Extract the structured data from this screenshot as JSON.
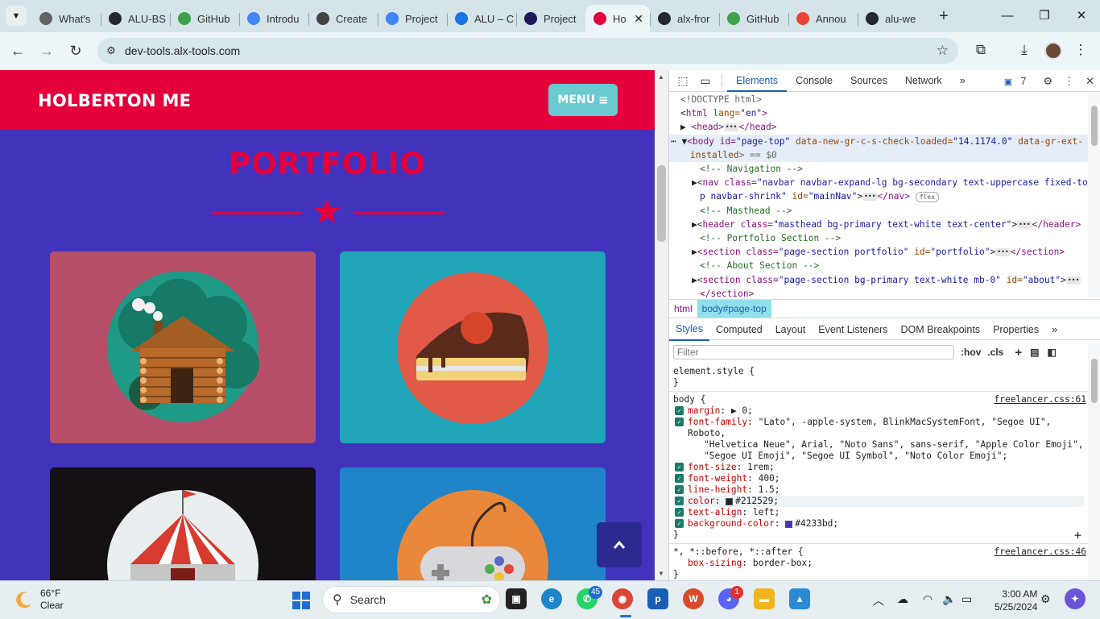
{
  "browser": {
    "tabs": [
      {
        "title": "What's",
        "icon": "chrome-icon",
        "color": "#5f6368"
      },
      {
        "title": "ALU-BS",
        "icon": "github-icon",
        "color": "#24292f"
      },
      {
        "title": "GitHub",
        "icon": "github-icon",
        "color": "#3fa14a"
      },
      {
        "title": "Introdu",
        "icon": "docs-icon",
        "color": "#4285f4"
      },
      {
        "title": "Create",
        "icon": "openai-icon",
        "color": "#444"
      },
      {
        "title": "Project",
        "icon": "docs-icon",
        "color": "#4285f4"
      },
      {
        "title": "ALU – C",
        "icon": "calendar-icon",
        "color": "#1a73e8"
      },
      {
        "title": "Project",
        "icon": "alx-icon",
        "color": "#1c1c5c"
      },
      {
        "title": "Ho",
        "icon": "holberton-icon",
        "color": "#e6003b",
        "active": true
      },
      {
        "title": "alx-fror",
        "icon": "github-icon",
        "color": "#24292f"
      },
      {
        "title": "GitHub",
        "icon": "github-icon",
        "color": "#3fa14a"
      },
      {
        "title": "Annou",
        "icon": "gmail-icon",
        "color": "#ea4335"
      },
      {
        "title": "alu-we",
        "icon": "github-icon",
        "color": "#24292f"
      }
    ],
    "url": "dev-tools.alx-tools.com"
  },
  "page": {
    "brand": "HOLBERTON ME",
    "menu_label": "MENU",
    "title": "PORTFOLIO",
    "cards": [
      {
        "name": "cabin",
        "color": "#b84f68"
      },
      {
        "name": "cake",
        "color": "#1fa4b8"
      },
      {
        "name": "circus",
        "color": "#141014"
      },
      {
        "name": "game",
        "color": "#1f84c8"
      }
    ],
    "bg_color": "#4233bd",
    "accent_color": "#e6003b"
  },
  "devtools": {
    "tabs": [
      "Elements",
      "Console",
      "Sources",
      "Network"
    ],
    "issues_count": "7",
    "dom": [
      {
        "t": "doctype",
        "text": "<!DOCTYPE html>"
      },
      {
        "t": "open",
        "tag": "html",
        "attrs": " lang=",
        "val": "\"en\"",
        "end": ">"
      },
      {
        "t": "collapsed",
        "text": "<head>",
        "close": "</head>"
      },
      {
        "t": "body1",
        "pre": "<body id=",
        "id": "\"page-top\"",
        "attr2": " data-new-gr-c-s-check-loaded=",
        "v2": "\"14.1174.0\"",
        "attr3": " data-gr-ext-"
      },
      {
        "t": "body2",
        "attr": "installed",
        "rest": "> == $0"
      },
      {
        "t": "comment",
        "text": "<!-- Navigation -->"
      },
      {
        "t": "nav1",
        "pre": "<nav class=",
        "val": "\"navbar navbar-expand-lg bg-secondary text-uppercase fixed-to"
      },
      {
        "t": "nav2",
        "val": "p navbar-shrink\"",
        "attr": " id=",
        "v2": "\"mainNav\"",
        "close": "</nav>",
        "badge": "flex"
      },
      {
        "t": "comment",
        "text": "<!-- Masthead -->"
      },
      {
        "t": "header",
        "pre": "<header class=",
        "val": "\"masthead bg-primary text-white text-center\"",
        "close": "</header>"
      },
      {
        "t": "comment",
        "text": "<!-- Portfolio Section -->"
      },
      {
        "t": "section",
        "pre": "<section class=",
        "val": "\"page-section portfolio\"",
        "attr": " id=",
        "v2": "\"portfolio\"",
        "close": "</section>"
      },
      {
        "t": "comment",
        "text": "<!-- About Section -->"
      },
      {
        "t": "section2",
        "pre": "<section class=",
        "val": "\"page-section bg-primary text-white mb-0\"",
        "attr": " id=",
        "v2": "\"about\""
      },
      {
        "t": "closesec",
        "text": "</section>"
      }
    ],
    "breadcrumbs": [
      "html",
      "body#page-top"
    ],
    "subtabs": [
      "Styles",
      "Computed",
      "Layout",
      "Event Listeners",
      "DOM Breakpoints",
      "Properties"
    ],
    "filter_placeholder": "Filter",
    "hov": ":hov",
    "cls": ".cls",
    "styles": {
      "element_style": "element.style {",
      "body_selector": "body {",
      "body_source": "freelancer.css:61",
      "props": [
        {
          "name": "margin",
          "value": "▶ 0;"
        },
        {
          "name": "font-family",
          "value": "\"Lato\", -apple-system, BlinkMacSystemFont, \"Segoe UI\", Roboto,"
        },
        {
          "name": "",
          "value": "\"Helvetica Neue\", Arial, \"Noto Sans\", sans-serif, \"Apple Color Emoji\","
        },
        {
          "name": "",
          "value": "\"Segoe UI Emoji\", \"Segoe UI Symbol\", \"Noto Color Emoji\";"
        },
        {
          "name": "font-size",
          "value": "1rem;"
        },
        {
          "name": "font-weight",
          "value": "400;"
        },
        {
          "name": "line-height",
          "value": "1.5;"
        },
        {
          "name": "color",
          "value": "#212529;",
          "swatch": "#212529"
        },
        {
          "name": "text-align",
          "value": "left;"
        },
        {
          "name": "background-color",
          "value": "#4233bd;",
          "swatch": "#4233bd"
        }
      ],
      "universal_selector": "*, *::before, *::after {",
      "universal_source": "freelancer.css:46",
      "universal_prop": {
        "name": "box-sizing",
        "value": "border-box;"
      }
    }
  },
  "taskbar": {
    "weather_temp": "66°F",
    "weather_desc": "Clear",
    "search_label": "Search",
    "whatsapp_badge": "45",
    "discord_badge": "1",
    "time": "3:00 AM",
    "date": "5/25/2024"
  }
}
